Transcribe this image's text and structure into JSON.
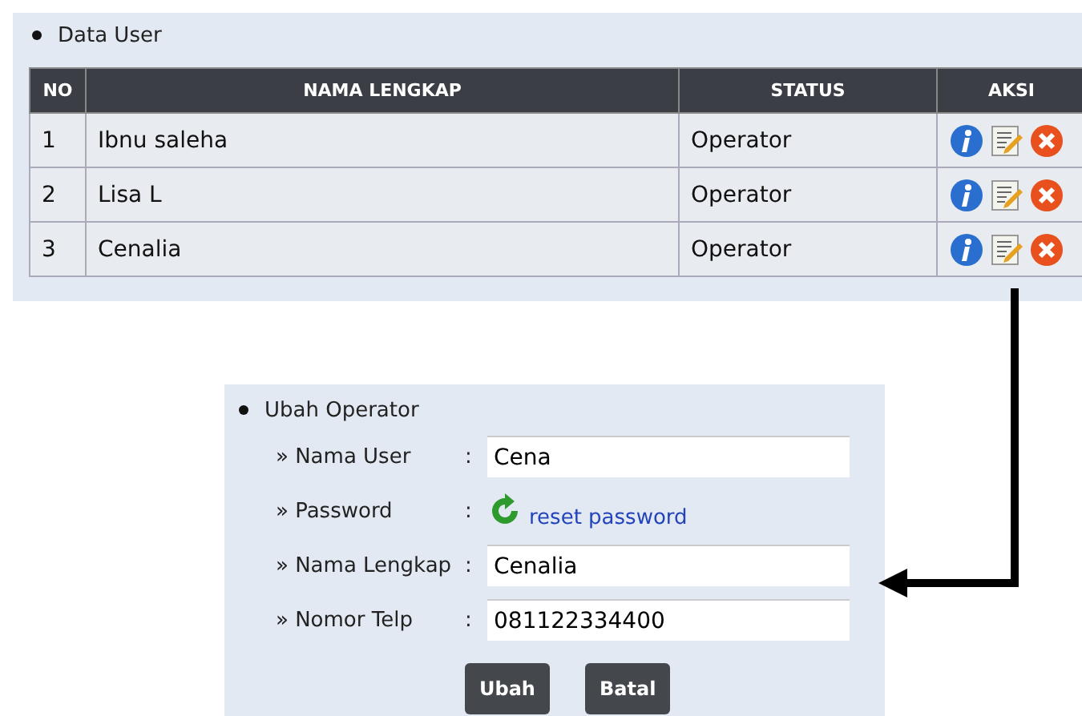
{
  "data_user": {
    "title": "Data User",
    "columns": [
      "NO",
      "NAMA LENGKAP",
      "STATUS",
      "AKSI"
    ],
    "rows": [
      {
        "no": "1",
        "nama": "Ibnu saleha",
        "status": "Operator"
      },
      {
        "no": "2",
        "nama": "Lisa L",
        "status": "Operator"
      },
      {
        "no": "3",
        "nama": "Cenalia",
        "status": "Operator"
      }
    ]
  },
  "ubah_operator": {
    "title": "Ubah Operator",
    "fields": [
      {
        "kind": "input",
        "label": "» Nama User",
        "separator": ":",
        "value": "Cena"
      },
      {
        "kind": "link",
        "label": "» Password",
        "separator": ":",
        "link": "reset password"
      },
      {
        "kind": "input",
        "label": "» Nama Lengkap",
        "separator": ":",
        "value": "Cenalia"
      },
      {
        "kind": "input",
        "label": "» Nomor Telp",
        "separator": ":",
        "value": "081122334400"
      }
    ],
    "buttons": [
      "Ubah",
      "Batal"
    ]
  }
}
